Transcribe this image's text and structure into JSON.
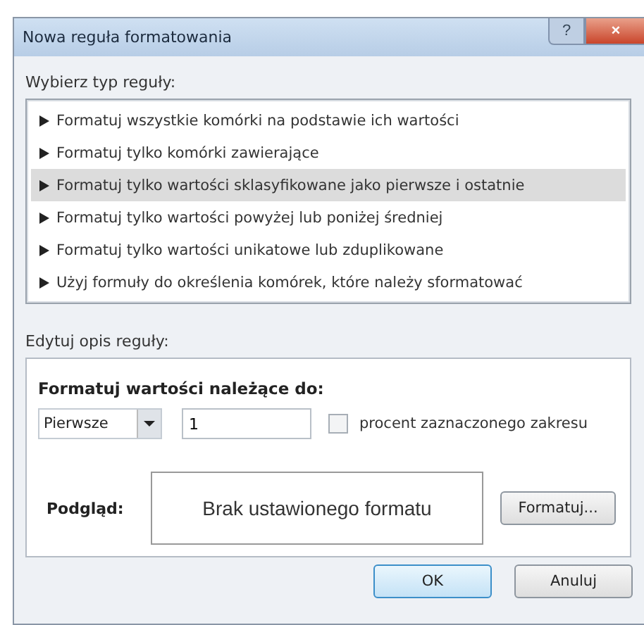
{
  "window": {
    "title": "Nowa reguła formatowania",
    "help": "?",
    "close": "×"
  },
  "rule_type": {
    "label": "Wybierz typ reguły:",
    "items": [
      {
        "label": "Formatuj wszystkie komórki na podstawie ich wartości",
        "selected": false
      },
      {
        "label": "Formatuj tylko komórki zawierające",
        "selected": false
      },
      {
        "label": "Formatuj tylko wartości sklasyfikowane jako pierwsze i ostatnie",
        "selected": true
      },
      {
        "label": "Formatuj tylko wartości powyżej lub poniżej średniej",
        "selected": false
      },
      {
        "label": "Formatuj tylko wartości unikatowe lub zduplikowane",
        "selected": false
      },
      {
        "label": "Użyj formuły do określenia komórek, które należy sformatować",
        "selected": false
      }
    ]
  },
  "description": {
    "label": "Edytuj opis reguły:",
    "heading": "Formatuj wartości należące do:",
    "rank": {
      "value": "Pierwsze"
    },
    "count": {
      "value": "1"
    },
    "percent": {
      "label": "procent zaznaczonego zakresu",
      "checked": false
    },
    "preview_label": "Podgląd:",
    "preview": "Brak ustawionego formatu",
    "format_button": "Formatuj..."
  },
  "buttons": [
    "OK",
    "Anuluj"
  ]
}
